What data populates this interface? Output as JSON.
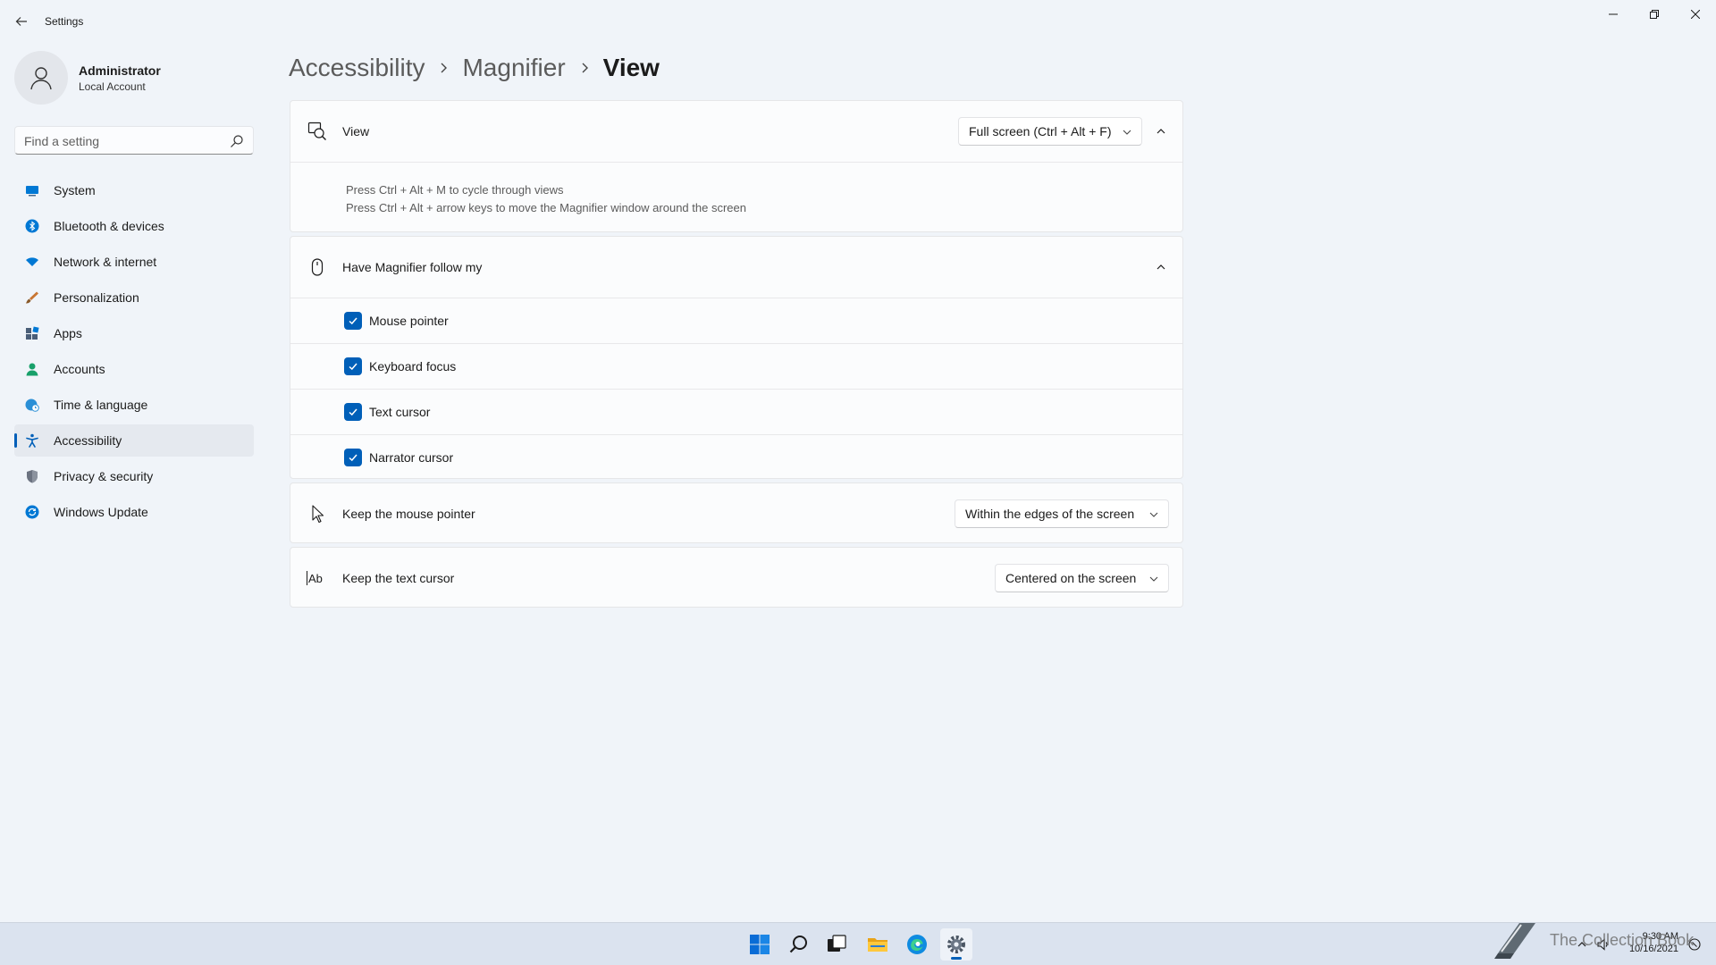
{
  "window": {
    "title": "Settings"
  },
  "user": {
    "name": "Administrator",
    "account_type": "Local Account"
  },
  "search": {
    "placeholder": "Find a setting"
  },
  "sidebar": {
    "items": [
      {
        "label": "System",
        "icon": "system-icon",
        "color": "#0078d4"
      },
      {
        "label": "Bluetooth & devices",
        "icon": "bluetooth-icon",
        "color": "#0078d4"
      },
      {
        "label": "Network & internet",
        "icon": "wifi-icon",
        "color": "#0078d4"
      },
      {
        "label": "Personalization",
        "icon": "brush-icon",
        "color": "#c87533"
      },
      {
        "label": "Apps",
        "icon": "apps-icon",
        "color": "#4a5e78"
      },
      {
        "label": "Accounts",
        "icon": "accounts-icon",
        "color": "#18a06a"
      },
      {
        "label": "Time & language",
        "icon": "globe-clock-icon",
        "color": "#2a8fd6"
      },
      {
        "label": "Accessibility",
        "icon": "accessibility-icon",
        "color": "#005fb8",
        "active": true
      },
      {
        "label": "Privacy & security",
        "icon": "shield-icon",
        "color": "#6b7280"
      },
      {
        "label": "Windows Update",
        "icon": "update-icon",
        "color": "#0078d4"
      }
    ]
  },
  "breadcrumb": {
    "items": [
      "Accessibility",
      "Magnifier",
      "View"
    ]
  },
  "view_card": {
    "label": "View",
    "dropdown_value": "Full screen (Ctrl + Alt + F)",
    "hints": [
      "Press Ctrl + Alt + M to cycle through views",
      "Press Ctrl + Alt + arrow keys to move the Magnifier window around the screen"
    ]
  },
  "follow_card": {
    "label": "Have Magnifier follow my",
    "options": [
      {
        "label": "Mouse pointer",
        "checked": true
      },
      {
        "label": "Keyboard focus",
        "checked": true
      },
      {
        "label": "Text cursor",
        "checked": true
      },
      {
        "label": "Narrator cursor",
        "checked": true
      }
    ]
  },
  "mouse_card": {
    "label": "Keep the mouse pointer",
    "dropdown_value": "Within the edges of the screen"
  },
  "text_cursor_card": {
    "label": "Keep the text cursor",
    "icon_text": "Ab",
    "dropdown_value": "Centered on the screen"
  },
  "taskbar": {
    "apps": [
      "start-icon",
      "search-icon",
      "task-view-icon",
      "file-explorer-icon",
      "edge-icon",
      "settings-icon"
    ],
    "time": "9:30 AM",
    "date": "10/16/2021"
  },
  "watermark": {
    "text": "The Collection Book"
  },
  "colors": {
    "accent": "#005fb8",
    "background": "#f0f4f9",
    "card": "#fbfcfd"
  }
}
